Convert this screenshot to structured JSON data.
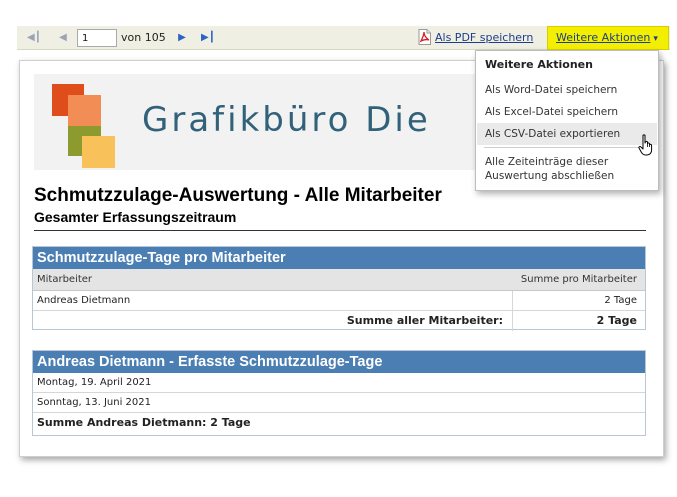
{
  "toolbar": {
    "nav_first_icon": "first-page-icon",
    "nav_prev_icon": "previous-page-icon",
    "page_value": "1",
    "page_of": "von 105",
    "nav_next_icon": "next-page-icon",
    "nav_last_icon": "last-page-icon",
    "pdf_icon": "pdf-icon",
    "pdf_label": "Als PDF speichern",
    "more_label": "Weitere Aktionen",
    "more_caret": "▾",
    "highlight_color": "#f4ef00"
  },
  "banner": {
    "brand_text": "Grafikbüro Die",
    "colors": [
      "#e04d1c",
      "#f28d55",
      "#8c9a2e",
      "#f9c15a"
    ]
  },
  "report": {
    "title": "Schmutzzulage-Auswertung - Alle Mitarbeiter",
    "subtitle": "Gesamter Erfassungszeitraum",
    "table1": {
      "heading": "Schmutzzulage-Tage pro Mitarbeiter",
      "col_employee": "Mitarbeiter",
      "col_sum": "Summe pro Mitarbeiter",
      "rows": [
        {
          "name": "Andreas Dietmann",
          "sum": "2 Tage"
        }
      ],
      "total_label": "Summe aller Mitarbeiter:",
      "total_value": "2 Tage"
    },
    "table2": {
      "heading": "Andreas Dietmann - Erfasste Schmutzzulage-Tage",
      "rows": [
        "Montag, 19. April 2021",
        "Sonntag, 13. Juni 2021"
      ],
      "total": "Summe Andreas Dietmann: 2 Tage"
    },
    "header_color": "#4b7fb3"
  },
  "menu": {
    "title": "Weitere Aktionen",
    "items": [
      "Als Word-Datei speichern",
      "Als Excel-Datei speichern",
      "Als CSV-Datei exportieren"
    ],
    "close_entries": "Alle Zeiteinträge dieser Auswertung abschließen",
    "cursor_icon": "hand-pointer-icon"
  }
}
